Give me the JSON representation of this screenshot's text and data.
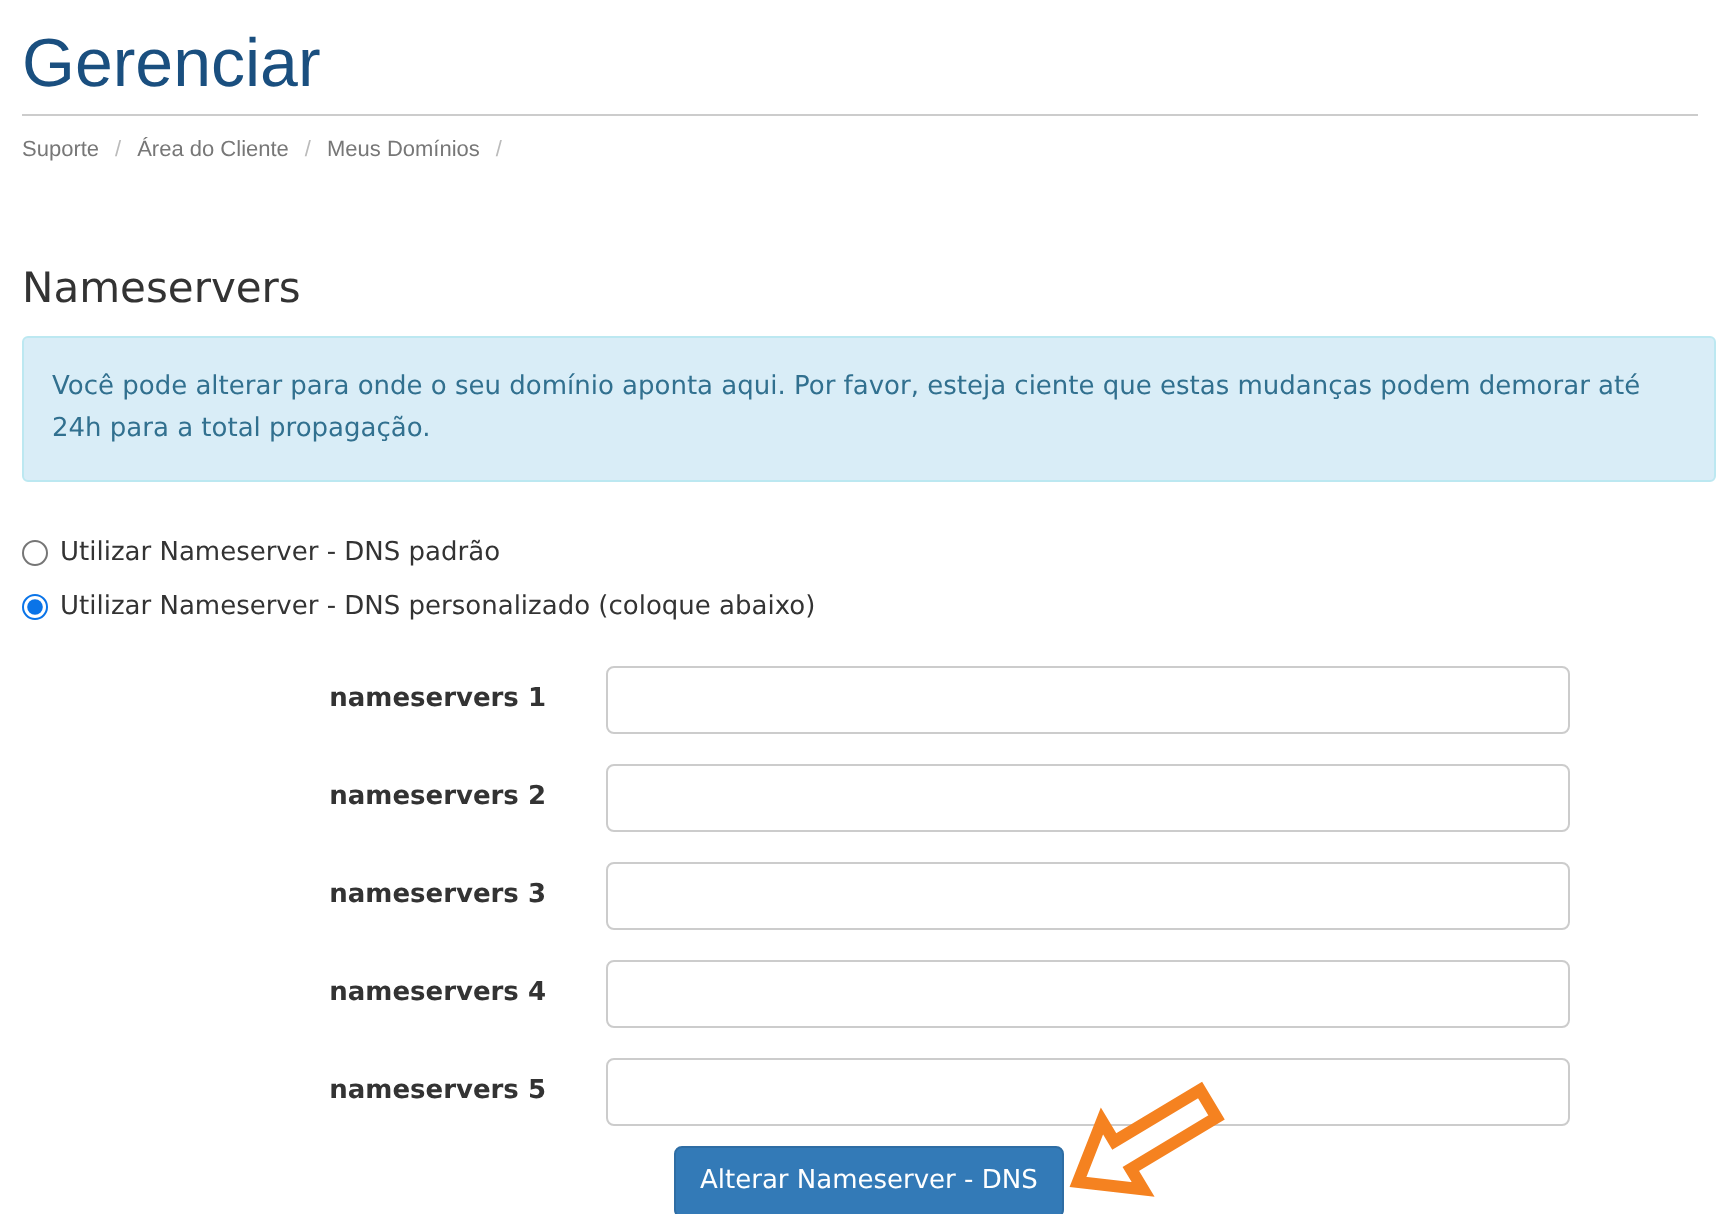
{
  "page_title": "Gerenciar",
  "breadcrumb": [
    {
      "label": "Suporte",
      "separator": "/"
    },
    {
      "label": "Área do Cliente",
      "separator": "/"
    },
    {
      "label": "Meus Domínios",
      "separator": "/"
    }
  ],
  "section_title": "Nameservers",
  "info_alert": "Você pode alterar para onde o seu domínio aponta aqui. Por favor, esteja ciente que estas mudanças podem demorar até 24h para a total propagação.",
  "options": [
    {
      "label": "Utilizar Nameserver - DNS padrão",
      "selected": false
    },
    {
      "label": "Utilizar Nameserver - DNS personalizado (coloque abaixo)",
      "selected": true
    }
  ],
  "fields": [
    {
      "label": "nameservers 1"
    },
    {
      "label": "nameservers 2"
    },
    {
      "label": "nameservers 3"
    },
    {
      "label": "nameservers 4"
    },
    {
      "label": "nameservers 5"
    }
  ],
  "submit_button": "Alterar Nameserver - DNS"
}
